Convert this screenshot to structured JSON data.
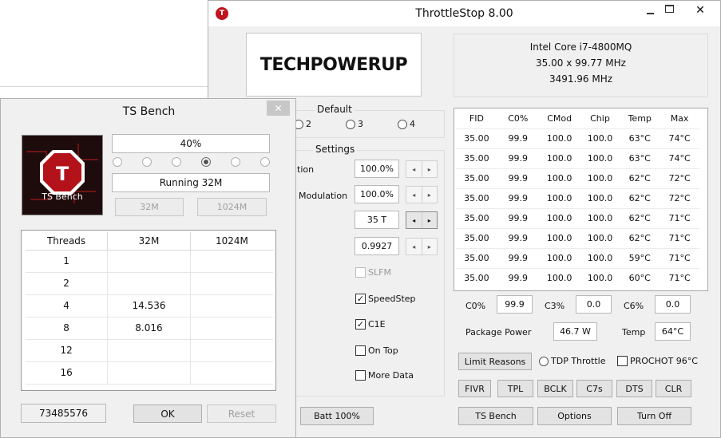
{
  "main": {
    "title": "ThrottleStop 8.00",
    "logo_text": "TECHPOWERUP",
    "cpu": {
      "name": "Intel Core i7-4800MQ",
      "multiplier_line": "35.00 x 99.77 MHz",
      "speed_line": "3491.96 MHz"
    },
    "profile_group": {
      "title": "Default",
      "options": [
        "2",
        "3",
        "4"
      ]
    },
    "settings_group": {
      "title": "Settings"
    },
    "settings": {
      "row1_label": "tion",
      "row1_value": "100.0%",
      "row2_label": "Modulation",
      "row2_value": "100.0%",
      "row3_value": "35 T",
      "row4_value": "0.9927",
      "slfm_label": "SLFM",
      "speedstep_label": "SpeedStep",
      "c1e_label": "C1E",
      "ontop_label": "On Top",
      "moredata_label": "More Data"
    },
    "table": {
      "headers": [
        "FID",
        "C0%",
        "CMod",
        "Chip",
        "Temp",
        "Max"
      ],
      "rows": [
        [
          "35.00",
          "99.9",
          "100.0",
          "100.0",
          "63°C",
          "74°C"
        ],
        [
          "35.00",
          "99.9",
          "100.0",
          "100.0",
          "63°C",
          "74°C"
        ],
        [
          "35.00",
          "99.9",
          "100.0",
          "100.0",
          "62°C",
          "72°C"
        ],
        [
          "35.00",
          "99.9",
          "100.0",
          "100.0",
          "62°C",
          "72°C"
        ],
        [
          "35.00",
          "99.9",
          "100.0",
          "100.0",
          "62°C",
          "71°C"
        ],
        [
          "35.00",
          "99.9",
          "100.0",
          "100.0",
          "62°C",
          "71°C"
        ],
        [
          "35.00",
          "99.9",
          "100.0",
          "100.0",
          "59°C",
          "71°C"
        ],
        [
          "35.00",
          "99.9",
          "100.0",
          "100.0",
          "60°C",
          "71°C"
        ]
      ]
    },
    "stats": {
      "c0_label": "C0%",
      "c0_value": "99.9",
      "c3_label": "C3%",
      "c3_value": "0.0",
      "c6_label": "C6%",
      "c6_value": "0.0",
      "pkg_label": "Package Power",
      "pkg_value": "46.7 W",
      "temp_label": "Temp",
      "temp_value": "64°C"
    },
    "limit_reasons_label": "Limit Reasons",
    "tdp_throttle_label": "TDP Throttle",
    "prochot_label": "PROCHOT 96°C",
    "tool_buttons": [
      "FIVR",
      "TPL",
      "BCLK",
      "C7s",
      "DTS",
      "CLR"
    ],
    "batt_label": "Batt 100%",
    "tsbench_label": "TS Bench",
    "options_label": "Options",
    "turnoff_label": "Turn Off",
    "accent": "#c0141e"
  },
  "bench": {
    "title": "TS Bench",
    "close_glyph": "✕",
    "logo_caption": "TS Bench",
    "progress_text": "40%",
    "status_text": "Running 32M",
    "size_buttons": [
      "32M",
      "1024M"
    ],
    "table": {
      "headers": [
        "Threads",
        "32M",
        "1024M"
      ],
      "rows": [
        [
          "1",
          "",
          ""
        ],
        [
          "2",
          "",
          ""
        ],
        [
          "4",
          "14.536",
          ""
        ],
        [
          "8",
          "8.016",
          ""
        ],
        [
          "12",
          "",
          ""
        ],
        [
          "16",
          "",
          ""
        ]
      ]
    },
    "score": "73485576",
    "ok_label": "OK",
    "reset_label": "Reset"
  }
}
